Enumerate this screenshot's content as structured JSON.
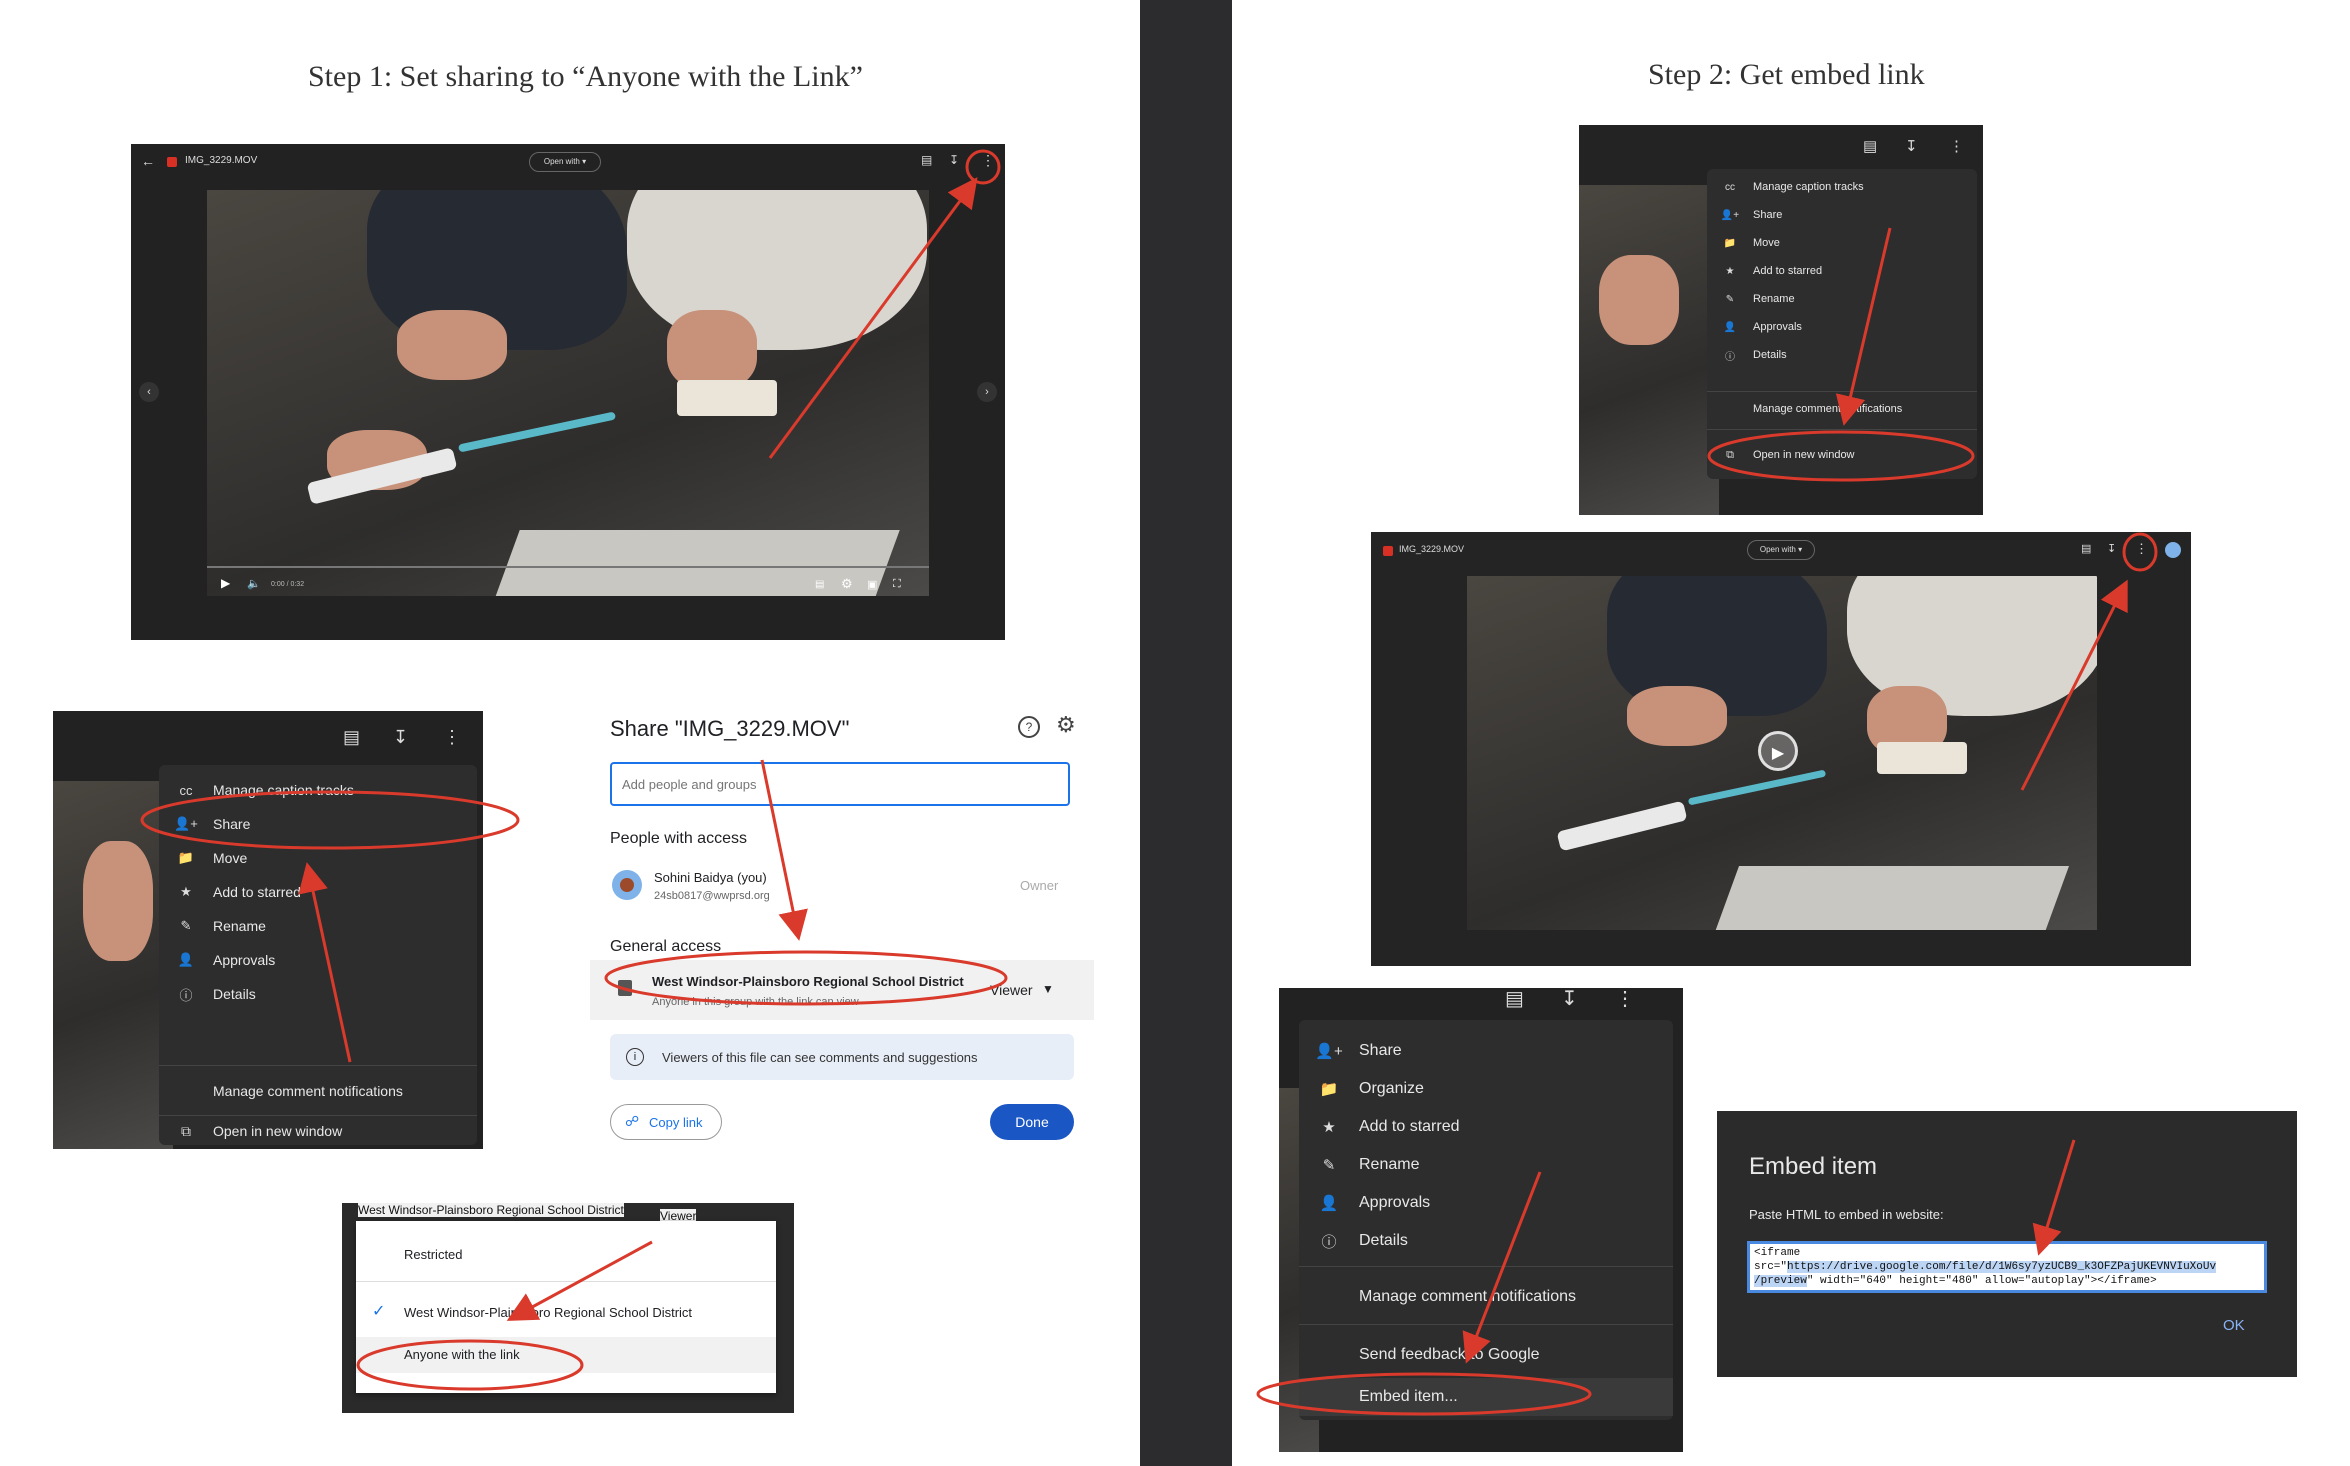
{
  "step1": {
    "title": "Step 1: Set sharing to “Anyone with the Link”"
  },
  "step2": {
    "title": "Step 2: Get embed link"
  },
  "viewer": {
    "filename": "IMG_3229.MOV",
    "open_with": "Open with",
    "time": "0:00 / 0:32"
  },
  "menu": {
    "items": [
      "Manage caption tracks",
      "Share",
      "Move",
      "Add to starred",
      "Rename",
      "Approvals",
      "Details"
    ],
    "comment_notifications": "Manage comment notifications",
    "open_new_window": "Open in new window"
  },
  "share": {
    "title": "Share \"IMG_3229.MOV\"",
    "placeholder": "Add people and groups",
    "people_heading": "People with access",
    "person_name": "Sohini Baidya (you)",
    "person_email": "24sb0817@wwprsd.org",
    "person_role": "Owner",
    "general_heading": "General access",
    "access_option": "West Windsor-Plainsboro Regional School District",
    "access_role": "Viewer",
    "access_desc": "Anyone in this group with the link can view",
    "info_text": "Viewers of this file can see comments and suggestions",
    "copy_link": "Copy link",
    "done": "Done"
  },
  "access_dropdown": {
    "header_option": "West Windsor-Plainsboro Regional School District",
    "header_role": "Viewer",
    "options": [
      "Restricted",
      "West Windsor-Plainsboro Regional School District",
      "Anyone with the link"
    ]
  },
  "menu2": {
    "items": [
      "Share",
      "Organize",
      "Add to starred",
      "Rename",
      "Approvals",
      "Details"
    ],
    "comment_notifications": "Manage comment notifications",
    "send_feedback": "Send feedback to Google",
    "embed_item": "Embed item..."
  },
  "embed": {
    "title": "Embed item",
    "label": "Paste HTML to embed in website:",
    "code_line1": "<iframe",
    "code_line2_pre": "src=\"",
    "code_url_a": "https://drive.google.com/file/d/1W6sy7yzUCB9_k3OFZPajUKEVNVIuXoUv",
    "code_url_b": "/preview",
    "code_line3_post": "\" width=\"640\" height=\"480\" allow=\"autoplay\"></iframe>",
    "ok": "OK"
  },
  "colors": {
    "annotation_red": "#d93a2b",
    "dark_bg": "#262626",
    "blue_button": "#1a73e8"
  }
}
